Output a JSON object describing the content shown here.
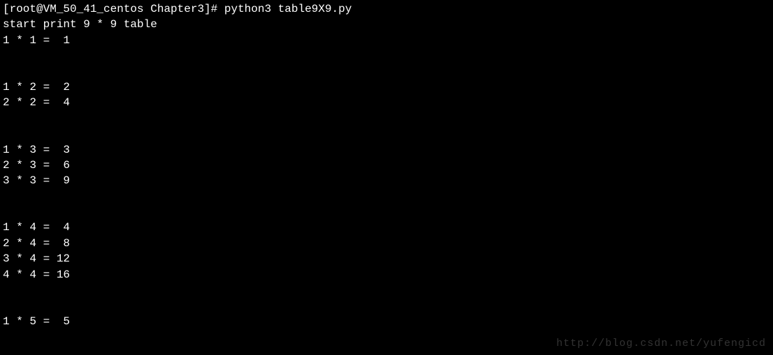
{
  "terminal": {
    "prompt": "[root@VM_50_41_centos Chapter3]# ",
    "command": "python3 table9X9.py",
    "header": "start print 9 * 9 table",
    "groups": [
      [
        "1 * 1 =  1"
      ],
      [
        "1 * 2 =  2",
        "2 * 2 =  4"
      ],
      [
        "1 * 3 =  3",
        "2 * 3 =  6",
        "3 * 3 =  9"
      ],
      [
        "1 * 4 =  4",
        "2 * 4 =  8",
        "3 * 4 = 12",
        "4 * 4 = 16"
      ],
      [
        "1 * 5 =  5"
      ]
    ]
  },
  "watermark": "http://blog.csdn.net/yufengicd"
}
